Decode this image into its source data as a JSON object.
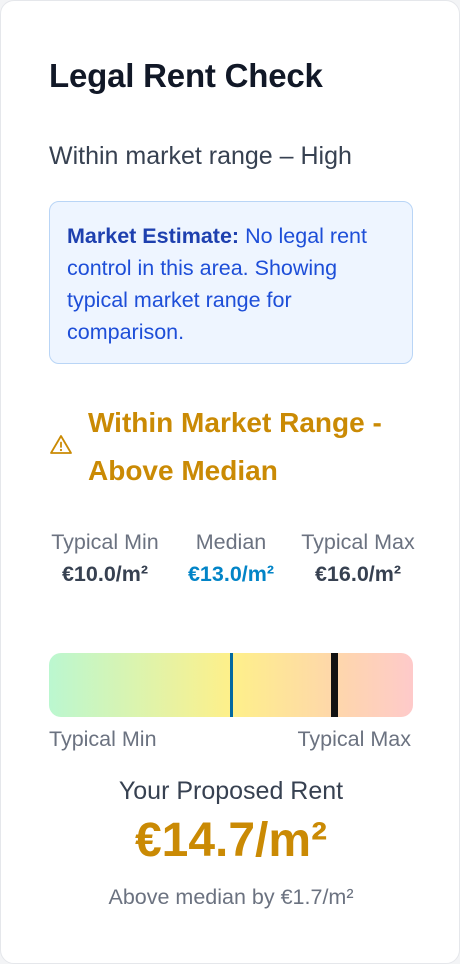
{
  "card": {
    "title": "Legal Rent Check",
    "subtitle": "Within market range – High"
  },
  "notice": {
    "label": "Market Estimate:",
    "text": "No legal rent control in this area. Showing typical market range for comparison."
  },
  "status": {
    "icon": "warning-icon",
    "text": "Within Market Range - Above Median",
    "color": "#ca8a04"
  },
  "stats": {
    "min": {
      "label": "Typical Min",
      "value": "€10.0/m²"
    },
    "median": {
      "label": "Median",
      "value": "€13.0/m²"
    },
    "max": {
      "label": "Typical Max",
      "value": "€16.0/m²"
    }
  },
  "range": {
    "min": 10.0,
    "max": 16.0,
    "median": 13.0,
    "proposed": 14.7,
    "min_label": "Typical Min",
    "max_label": "Typical Max"
  },
  "proposed": {
    "label": "Your Proposed Rent",
    "value": "€14.7/m²",
    "note": "Above median by €1.7/m²"
  }
}
